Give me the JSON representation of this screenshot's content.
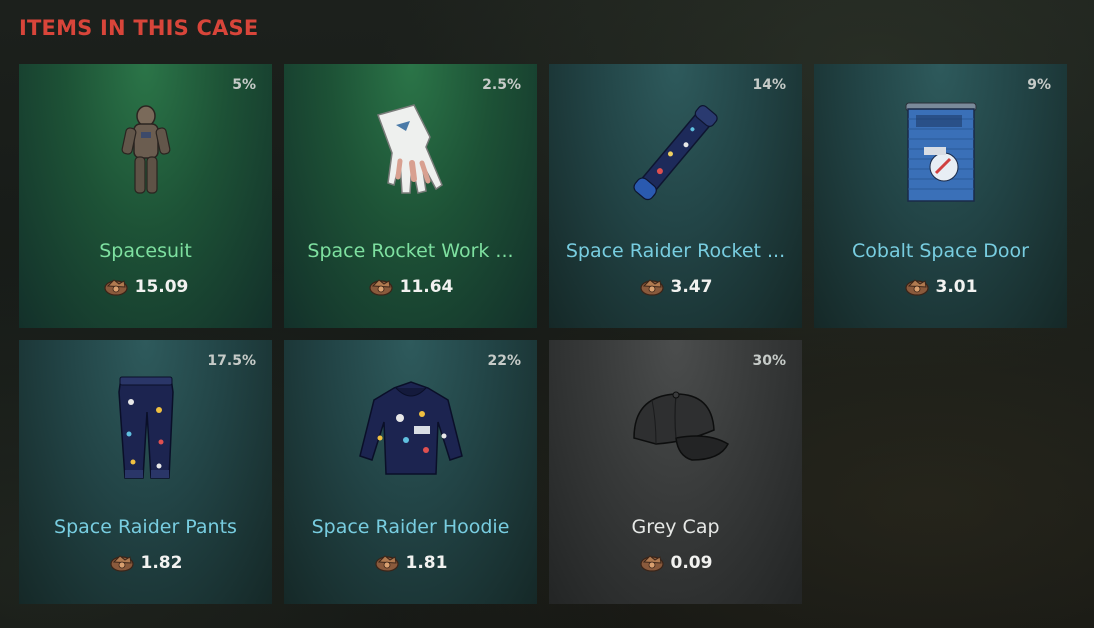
{
  "section": {
    "title": "ITEMS IN THIS CASE"
  },
  "colors": {
    "title": "#d8453a",
    "rarity_green_name": "#7ee0a0",
    "rarity_teal_name": "#78cde0",
    "rarity_grey_name": "#e6e8e6"
  },
  "items": [
    {
      "chance": "5%",
      "name": "Spacesuit",
      "price": "15.09",
      "rarity": "green",
      "icon": "spacesuit-icon"
    },
    {
      "chance": "2.5%",
      "name": "Space Rocket Work ...",
      "price": "11.64",
      "rarity": "green",
      "icon": "glove-icon"
    },
    {
      "chance": "14%",
      "name": "Space Raider Rocket ...",
      "price": "3.47",
      "rarity": "teal",
      "icon": "rocket-launcher-icon"
    },
    {
      "chance": "9%",
      "name": "Cobalt Space Door",
      "price": "3.01",
      "rarity": "teal",
      "icon": "garage-door-icon"
    },
    {
      "chance": "17.5%",
      "name": "Space Raider Pants",
      "price": "1.82",
      "rarity": "teal",
      "icon": "pants-icon"
    },
    {
      "chance": "22%",
      "name": "Space Raider Hoodie",
      "price": "1.81",
      "rarity": "teal",
      "icon": "hoodie-icon"
    },
    {
      "chance": "30%",
      "name": "Grey Cap",
      "price": "0.09",
      "rarity": "grey",
      "icon": "cap-icon"
    }
  ],
  "currency_icon": "scrap-icon"
}
